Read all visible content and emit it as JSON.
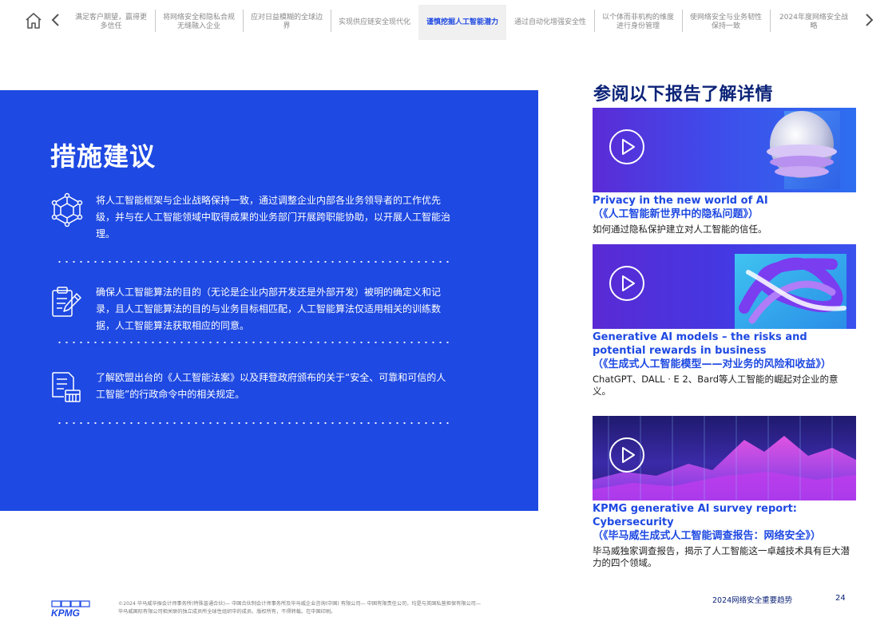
{
  "nav": {
    "tabs": [
      {
        "label": "满足客户期望，赢得更多信任",
        "active": false
      },
      {
        "label": "将网络安全和隐私合规无缝融入企业",
        "active": false
      },
      {
        "label": "应对日益模糊的全球边界",
        "active": false
      },
      {
        "label": "实现供应链安全现代化",
        "active": false
      },
      {
        "label": "谨慎挖掘人工智能潜力",
        "active": true
      },
      {
        "label": "通过自动化增强安全性",
        "active": false
      },
      {
        "label": "以个体而非机构的维度进行身份管理",
        "active": false
      },
      {
        "label": "使网络安全与业务韧性保持一致",
        "active": false
      },
      {
        "label": "2024年度网络安全战略",
        "active": false
      }
    ],
    "icons": {
      "home": "home-icon",
      "prev": "chevron-left-icon",
      "next": "chevron-right-icon"
    }
  },
  "panel": {
    "title": "措施建议",
    "items": [
      {
        "icon": "network-hexagon-icon",
        "text": "将人工智能框架与企业战略保持一致，通过调整企业内部各业务领导者的工作优先级，并与在人工智能领域中取得成果的业务部门开展跨职能协助，以开展人工智能治理。"
      },
      {
        "icon": "clipboard-edit-icon",
        "text": "确保人工智能算法的目的（无论是企业内部开发还是外部开发）被明的确定义和记录，且人工智能算法的目的与业务目标相匹配，人工智能算法仅适用相关的训练数据，人工智能算法获取相应的同意。"
      },
      {
        "icon": "document-law-icon",
        "text": "了解欧盟出台的《人工智能法案》以及拜登政府颁布的关于“安全、可靠和可信的人工智能”的行政命令中的相关规定。"
      }
    ]
  },
  "reports": {
    "heading": "参阅以下报告了解详情",
    "cards": [
      {
        "title_en": "Privacy in the new world of AI",
        "title_cn": "（《人工智能新世界中的隐私问题》）",
        "desc": "如何通过隐私保护建立对人工智能的信任。",
        "icon": "play-icon"
      },
      {
        "title_en": "Generative AI models – the risks and potential rewards in business",
        "title_cn": "（《生成式人工智能模型——对业务的风险和收益》）",
        "desc": "ChatGPT、DALL · E 2、Bard等人工智能的崛起对企业的意义。",
        "icon": "play-icon"
      },
      {
        "title_en": "KPMG generative AI survey report: Cybersecurity",
        "title_cn": "（《毕马威生成式人工智能调查报告：网络安全》）",
        "desc": "毕马威独家调查报告，揭示了人工智能这一卓越技术具有巨大潜力的四个领域。",
        "icon": "play-icon"
      }
    ]
  },
  "footer": {
    "logo": "KPMG",
    "legal": "©2024 毕马威华振会计师事务所(特殊普通合伙)— 中国合伙制会计师事务所及毕马威企业咨询(中国) 有限公司— 中国有限责任公司，均是与英国私营担保有限公司—毕马威国际有限公司相关联的独立成员所全球性组织中的成员。版权所有，不得转载。在中国印刷。",
    "doc_title": "2024网络安全重要趋势",
    "page": "24"
  },
  "colors": {
    "brand_blue": "#1e49e2",
    "navy": "#0c2378",
    "tab_active_bg": "#f0f0f0"
  }
}
